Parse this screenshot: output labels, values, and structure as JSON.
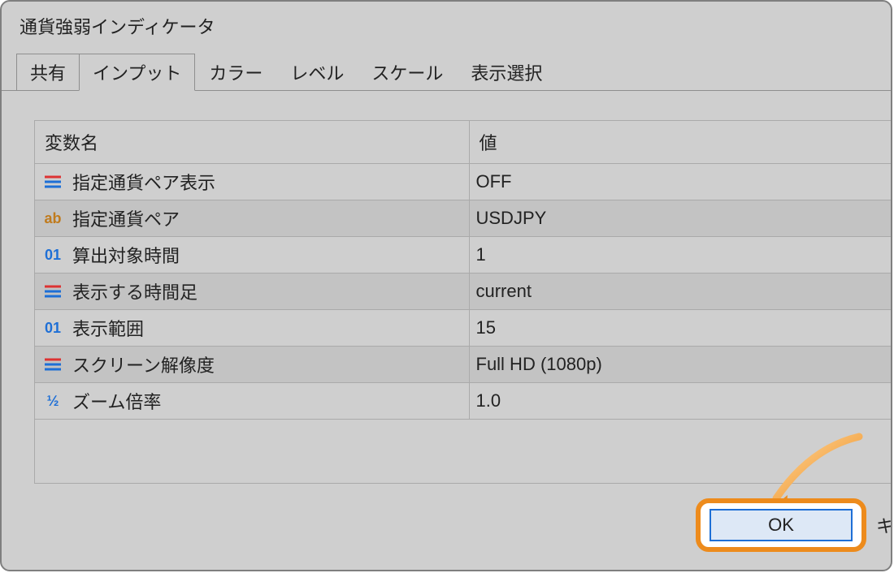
{
  "window": {
    "title": "通貨強弱インディケータ"
  },
  "tabs": [
    {
      "name": "share",
      "label": "共有",
      "active": false
    },
    {
      "name": "input",
      "label": "インプット",
      "active": true
    },
    {
      "name": "color",
      "label": "カラー",
      "active": false
    },
    {
      "name": "level",
      "label": "レベル",
      "active": false
    },
    {
      "name": "scale",
      "label": "スケール",
      "active": false
    },
    {
      "name": "display",
      "label": "表示選択",
      "active": false
    }
  ],
  "columns": {
    "name": "変数名",
    "value": "値"
  },
  "rows": [
    {
      "icon": "enum",
      "name": "指定通貨ペア表示",
      "value": "OFF"
    },
    {
      "icon": "str",
      "name": "指定通貨ペア",
      "value": "USDJPY"
    },
    {
      "icon": "int",
      "name": "算出対象時間",
      "value": "1"
    },
    {
      "icon": "enum",
      "name": "表示する時間足",
      "value": "current"
    },
    {
      "icon": "int",
      "name": "表示範囲",
      "value": "15"
    },
    {
      "icon": "enum",
      "name": "スクリーン解像度",
      "value": "Full HD (1080p)"
    },
    {
      "icon": "frac",
      "name": "ズーム倍率",
      "value": "1.0"
    }
  ],
  "buttons": {
    "ok": "OK",
    "cancel": "キ"
  },
  "icon_labels": {
    "str": "ab",
    "int": "01",
    "frac": "½"
  }
}
